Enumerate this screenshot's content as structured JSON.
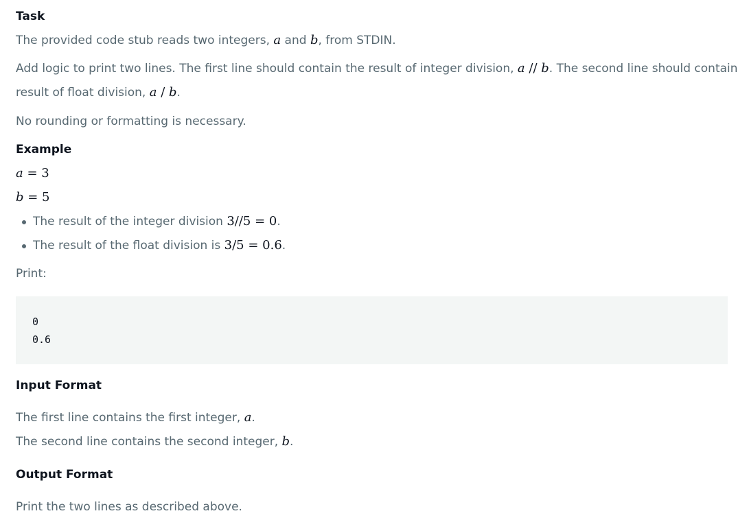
{
  "task": {
    "heading": "Task",
    "intro_pre": "The provided code stub reads two integers, ",
    "var_a": "a",
    "intro_mid": " and ",
    "var_b": "b",
    "intro_post": ", from STDIN.",
    "para2_a": "Add logic to print two lines. The first line should contain the result of integer division, ",
    "para2_a_var": "a",
    "para2_a_op": " // ",
    "para2_a_var2": "b",
    "para2_a_post": ". The second line should contain the",
    "para2_b_pre": "result of float division, ",
    "para2_b_var": "a",
    "para2_b_op": " / ",
    "para2_b_var2": "b",
    "para2_b_post": ".",
    "para3": "No rounding or formatting is necessary."
  },
  "example": {
    "heading": "Example",
    "eq_a_var": "a",
    "eq_a_rest": " = 3",
    "eq_b_var": "b",
    "eq_b_rest": " = 5",
    "bullet1_text": "The result of the integer division ",
    "bullet1_math": "3//5 = 0",
    "bullet1_end": ".",
    "bullet2_text": "The result of the float division is ",
    "bullet2_math": "3/5 = 0.6",
    "bullet2_end": ".",
    "print_label": "Print:",
    "code_lines": [
      "0",
      "0.6"
    ]
  },
  "input_format": {
    "heading": "Input Format",
    "line1_pre": "The first line contains the first integer, ",
    "line1_var": "a",
    "line1_post": ".",
    "line2_pre": "The second line contains the second integer, ",
    "line2_var": "b",
    "line2_post": "."
  },
  "output_format": {
    "heading": "Output Format",
    "line1": "Print the two lines as described above."
  }
}
